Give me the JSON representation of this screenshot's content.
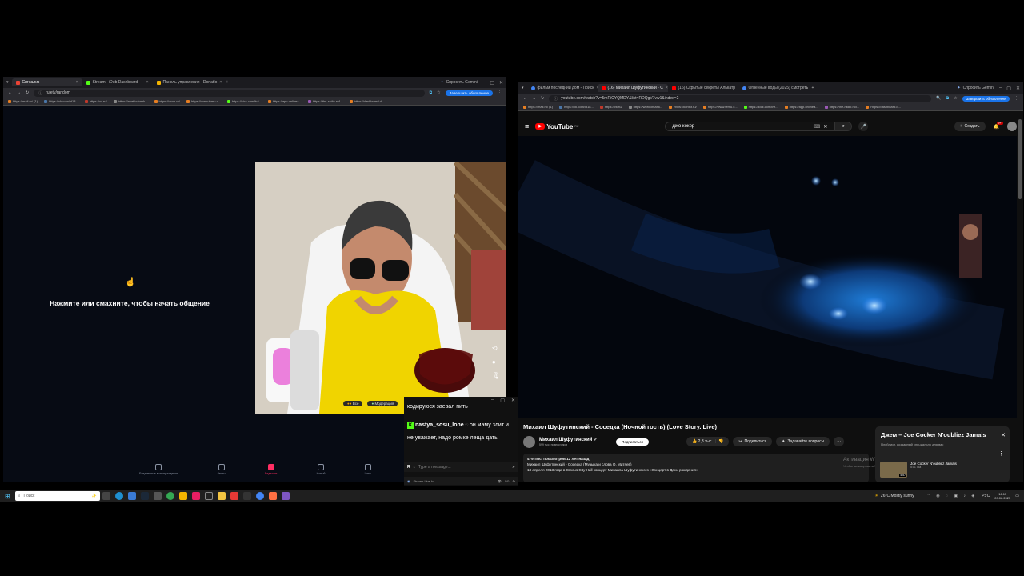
{
  "left_browser": {
    "tabs": [
      {
        "label": "Сигнализ",
        "color": "#ea4335",
        "active": true
      },
      {
        "label": "Stream - iDub Dashboard",
        "color": "#53fc18",
        "active": false
      },
      {
        "label": "Панель управления - DonatIo",
        "color": "#f4b400",
        "active": false
      }
    ],
    "gemini_label": "Спросить Gemini",
    "url": "ruletv/random",
    "update_label": "Завершить обновление",
    "bookmarks": [
      "https://mail.ru/ (1)",
      "https://vk.com/id18...",
      "https://vz.ru/",
      "https://avat.io/bank...",
      "https://ozon.ru/",
      "https://www.temu.c...",
      "https://kick.com/kvi...",
      "https://app.onlinea...",
      "https://the-radio.ru/i...",
      "https://dashboard.d..."
    ]
  },
  "chat_app": {
    "prompt": "Нажмите или смахните, чтобы начать общение",
    "nav": [
      "Ежедневные вознаграждения",
      "Ленты",
      "Видеочат",
      "Новый",
      "Чаты"
    ]
  },
  "overlay": {
    "donation_label": "Все",
    "moderate_label": "Модерация",
    "message_1": "кодируюся заевал пить",
    "chat_user": "nastya_sosu_lone",
    "message_2": "он маму злит и не уважает, надо ромке леща дать",
    "input_placeholder": "Type a message...",
    "stream_label": "Stream Live ka...",
    "viewers": "0/0"
  },
  "right_browser": {
    "tabs": [
      {
        "label": "фильм последний дом - Поиск",
        "color": "#4285f4",
        "active": false
      },
      {
        "label": "(16) Михаил Шуфутинский - С",
        "color": "#ff0000",
        "active": true
      },
      {
        "label": "(16) Скрытые секреты Алькатр",
        "color": "#ff0000",
        "active": false
      },
      {
        "label": "Огненные воды (2025) смотреть",
        "color": "#4285f4",
        "active": false
      }
    ],
    "gemini_label": "Спросить Gemini",
    "url": "youtube.com/watch?v=5mRiCYQMDY&list=RDQgV7vw1&index=2",
    "update_label": "Завершить обновление",
    "bookmarks": [
      "https://mail.ru/ (1)",
      "https://vk.com/id18...",
      "https://vk.ru/",
      "https://worldofkank...",
      "https://kontkt.ru/",
      "https://www.temu.c...",
      "https://kick.com/kvi...",
      "https://app.onlinea...",
      "https://the-radio.ru/i...",
      "https://dashboard.d..."
    ]
  },
  "youtube": {
    "logo": "YouTube",
    "region": "RU",
    "search_value": "джо кокер",
    "create_label": "Создать",
    "notif_count": "9+",
    "video_title": "Михаил Шуфутинский - Соседка (Ночной гость) (Love Story. Live)",
    "channel": "Михаил Шуфутинский",
    "subscribers": "599 тыс. подписчиков",
    "subscribe_label": "Подписаться",
    "likes": "2,3 тыс.",
    "share_label": "Поделиться",
    "ask_label": "Задавайте вопросы",
    "views_date": "479 тыс. просмотров  12 лет назад",
    "desc_line1": "Михаил Шуфутинский - Соседка (Музыка и слова О. Митяев)",
    "desc_line2": "13 апреля 2013 года в Crocus City Hall концерт Михаила Шуфутинского «Концерт в День рождения»",
    "mix_title": "Джем – Joe Cocker N'oubliez Jamais",
    "mix_subtitle": "Плейлист, созданный специально для вас",
    "playlist_item": "Joe Cocker N'oubliez Jamais",
    "playlist_sub": "5:01 Ilka",
    "playlist_time": "4:57",
    "windows_activation": "Активация Windows",
    "windows_activation_sub": "Чтобы активировать Windows, перейдите в раздел \"Параметры\"."
  },
  "taskbar": {
    "search_placeholder": "Поиск",
    "weather": "26°C  Mostly sunny",
    "lang": "РУС",
    "time": "16:15",
    "date": "09.06.2025"
  }
}
